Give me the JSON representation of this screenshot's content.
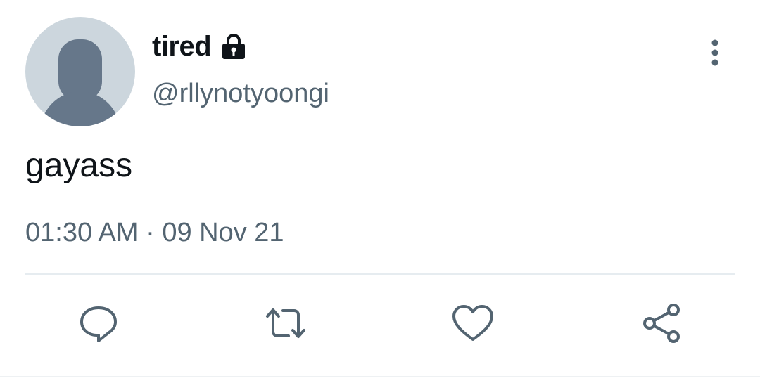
{
  "tweet": {
    "display_name": "tired",
    "handle": "@rllynotyoongi",
    "text": "gayass",
    "timestamp": "01:30 AM · 09 Nov 21",
    "protected_icon": "lock-icon"
  },
  "actions": {
    "reply_icon": "speech-bubble-icon",
    "retweet_icon": "retweet-icon",
    "like_icon": "heart-icon",
    "share_icon": "share-icon",
    "more_icon": "vertical-ellipsis-icon"
  },
  "colors": {
    "text_primary": "#0f1419",
    "text_secondary": "#536471",
    "avatar_bg": "#ccd6dd",
    "avatar_fg": "#66778a",
    "divider": "#e6ecf0"
  }
}
